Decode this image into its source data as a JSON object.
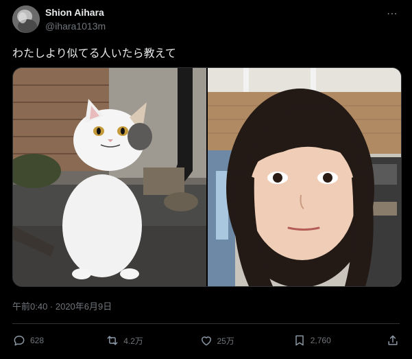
{
  "author": {
    "display_name": "Shion Aihara",
    "handle": "@ihara1013m"
  },
  "tweet": {
    "text": "わたしより似てる人いたら教えて",
    "timestamp": "午前0:40 · 2020年6月9日"
  },
  "media": [
    {
      "icon": "cat-photo"
    },
    {
      "icon": "person-photo"
    }
  ],
  "actions": {
    "replies": "628",
    "retweets": "4.2万",
    "likes": "25万",
    "bookmarks": "2,760"
  },
  "colors": {
    "background": "#000000",
    "text": "#e7e9ea",
    "muted": "#71767b",
    "border": "#2f3336"
  }
}
